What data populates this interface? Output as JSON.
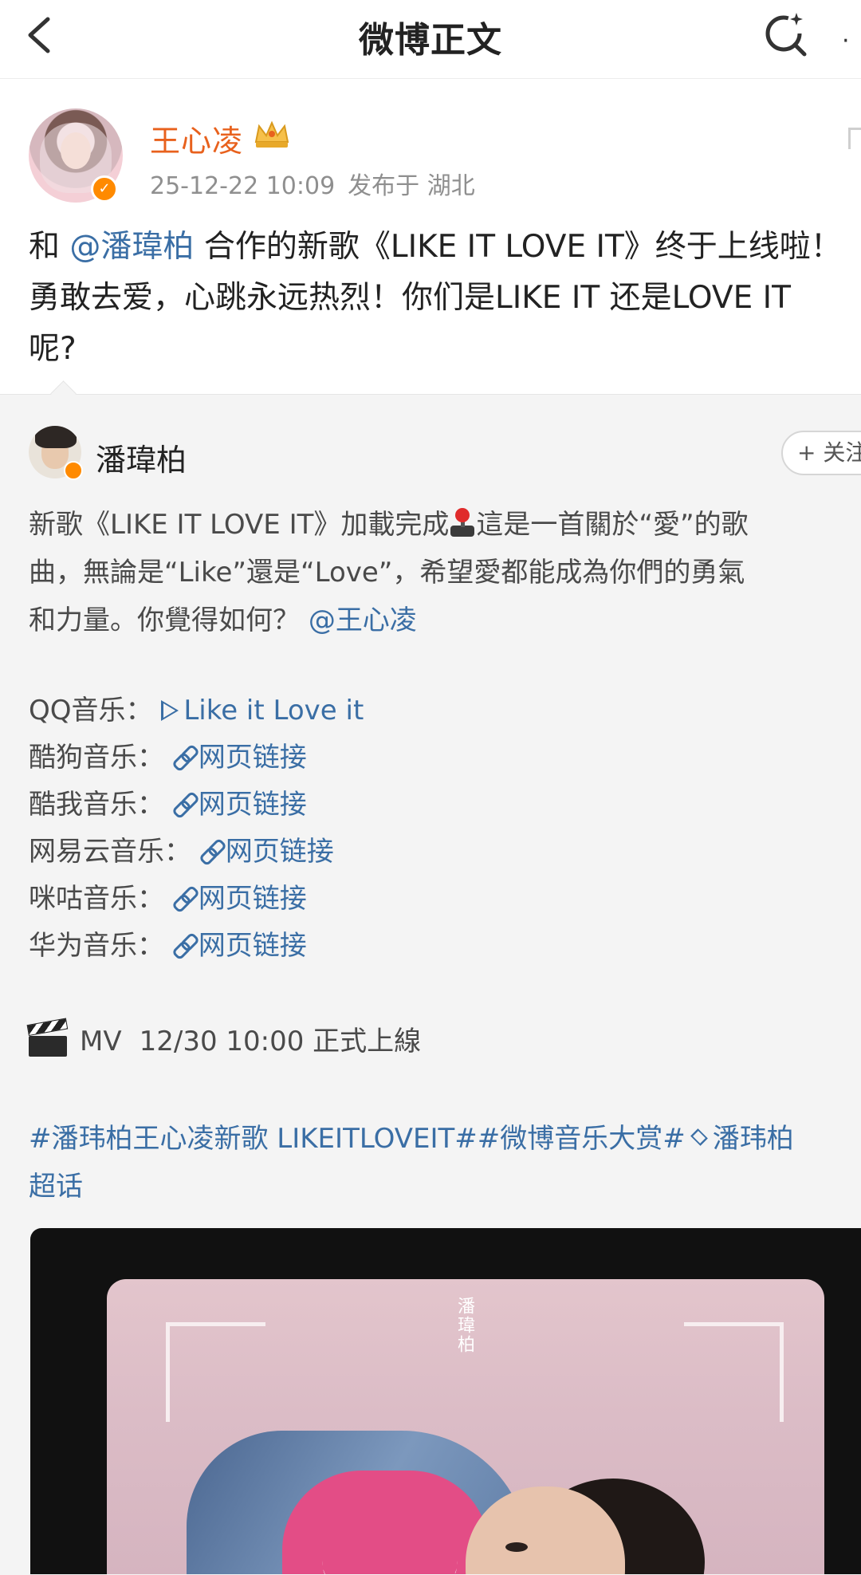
{
  "nav": {
    "title": "微博正文",
    "more": "·"
  },
  "post": {
    "author": "王心凌",
    "time": "25-12-22 10:09",
    "location": "发布于 湖北",
    "text_pre": "和",
    "mention": "@潘瑋柏",
    "text_line1_rest": "合作的新歌《LIKE IT LOVE IT》终于上线啦！",
    "text_line2": "勇敢去爱，心跳永远热烈！你们是LIKE IT 还是LOVE IT",
    "text_line3": "呢?"
  },
  "repost": {
    "author": "潘瑋柏",
    "follow_label": "+ 关注",
    "text_line1_a": "新歌《LIKE IT LOVE IT》加載完成",
    "text_line1_b": "這是一首關於“愛”的歌",
    "text_line2": "曲，無論是“Like”還是“Love”，希望愛都能成為你們的勇氣",
    "text_line3": "和力量。你覺得如何？",
    "mention": "@王心凌",
    "links": [
      {
        "platform": "QQ音乐：",
        "label": "Like it Love it",
        "icon": "play-icon"
      },
      {
        "platform": "酷狗音乐：",
        "label": "网页链接",
        "icon": "link-icon"
      },
      {
        "platform": "酷我音乐：",
        "label": "网页链接",
        "icon": "link-icon"
      },
      {
        "platform": "网易云音乐：",
        "label": "网页链接",
        "icon": "link-icon"
      },
      {
        "platform": "咪咕音乐：",
        "label": "网页链接",
        "icon": "link-icon"
      },
      {
        "platform": "华为音乐：",
        "label": "网页链接",
        "icon": "link-icon"
      }
    ],
    "mv_label": "MV",
    "mv_time": "12/30 10:00 正式上線",
    "hashtag1": "#潘玮柏王心凌新歌 LIKEITLOVEIT#",
    "hashtag2": "#微博音乐大赏#",
    "hashtag3": "潘玮柏",
    "hashtag_line2": "超话",
    "media_label": "潘瑋柏"
  },
  "colors": {
    "link": "#3a6ea5",
    "author_orange": "#e8611d",
    "verified": "#ff8a00",
    "repost_bg": "#f4f4f4"
  }
}
